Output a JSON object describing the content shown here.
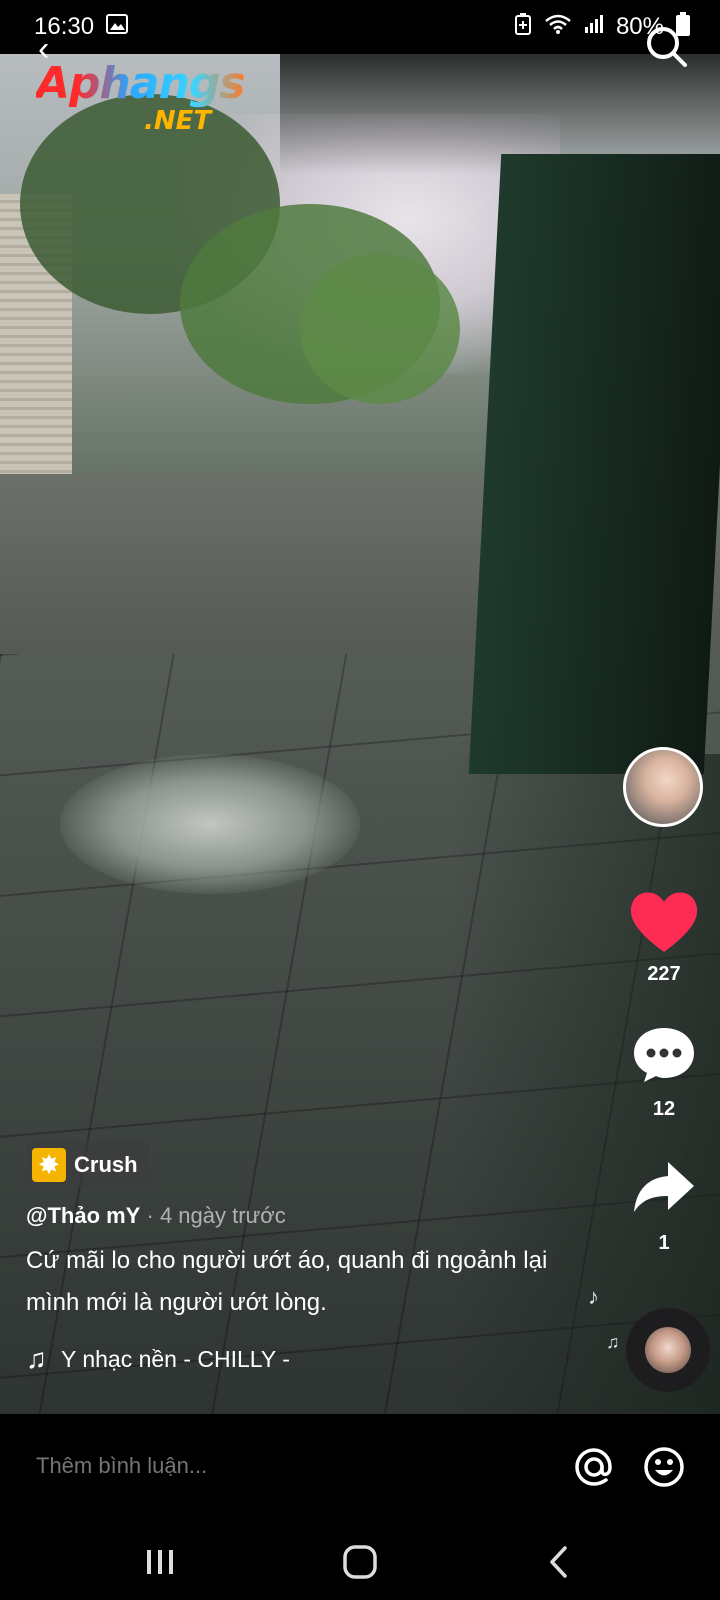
{
  "status_bar": {
    "time": "16:30",
    "battery": "80%",
    "icons": [
      "gallery-icon",
      "battery-saver-icon",
      "wifi-icon",
      "signal-icon",
      "battery-icon"
    ]
  },
  "watermark": {
    "line1": "Aphangs",
    "line2": ".NET"
  },
  "side_actions": {
    "like_count": "227",
    "comment_count": "12",
    "share_count": "1",
    "like_color": "#fe2c55"
  },
  "post": {
    "tag_label": "Crush",
    "username": "@Thảo mY",
    "separator": "·",
    "time_ago": "4 ngày trước",
    "caption": "Cứ mãi lo cho người ướt áo, quanh đi ngoảnh lại mình mới là người ướt lòng.",
    "music": "Y    nhạc nền - CHILLY -"
  },
  "comment_bar": {
    "placeholder": "Thêm bình luận..."
  },
  "nav": {
    "buttons": [
      "recents-icon",
      "home-icon",
      "back-icon"
    ]
  }
}
